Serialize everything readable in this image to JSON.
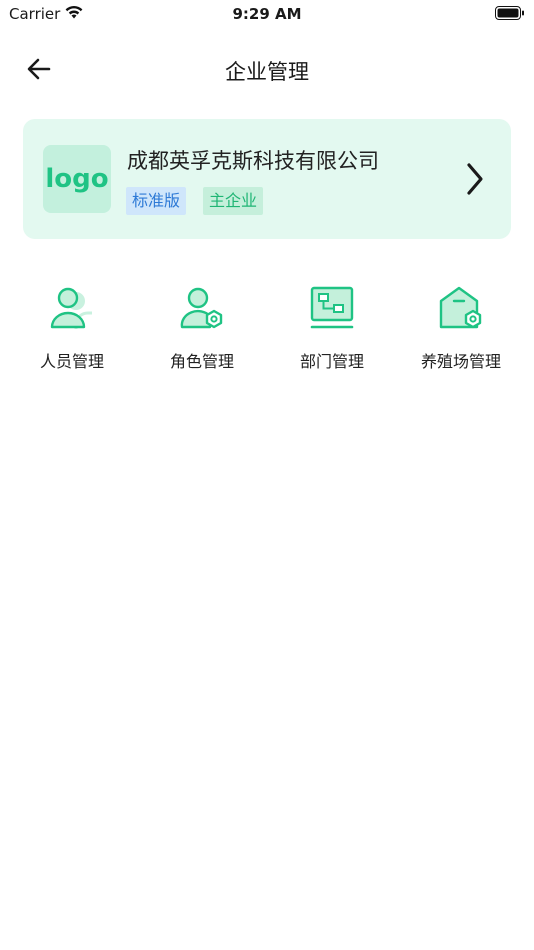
{
  "status_bar": {
    "carrier": "Carrier",
    "time": "9:29 AM"
  },
  "nav": {
    "title": "企业管理"
  },
  "company": {
    "logo_text": "logo",
    "name": "成都英孚克斯科技有限公司",
    "tags": [
      "标准版",
      "主企业"
    ]
  },
  "menu": [
    {
      "label": "人员管理",
      "icon": "person-icon"
    },
    {
      "label": "角色管理",
      "icon": "role-icon"
    },
    {
      "label": "部门管理",
      "icon": "department-icon"
    },
    {
      "label": "养殖场管理",
      "icon": "farm-icon"
    }
  ],
  "colors": {
    "accent": "#1fc384",
    "card_bg": "#e3f9f0",
    "tag_blue": "#2e7ad6"
  }
}
